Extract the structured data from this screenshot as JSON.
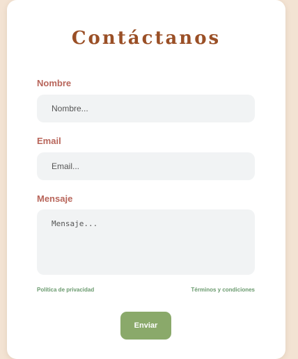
{
  "form": {
    "title": "Contáctanos",
    "name_label": "Nombre",
    "name_placeholder": "Nombre...",
    "email_label": "Email",
    "email_placeholder": "Email...",
    "message_label": "Mensaje",
    "message_placeholder": "Mensaje...",
    "privacy_link": "Política de privacidad",
    "terms_link": "Términos y condiciones",
    "submit_label": "Enviar"
  },
  "colors": {
    "background": "#f3e3d3",
    "title": "#9a4f26",
    "label": "#b8655a",
    "link": "#6a9a6e",
    "button": "#8aa96a"
  }
}
